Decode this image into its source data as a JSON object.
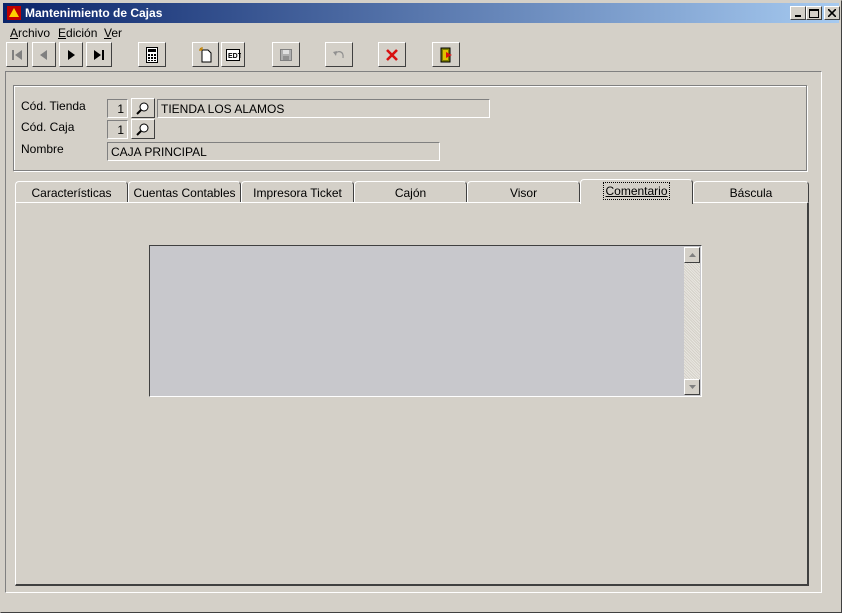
{
  "window": {
    "title": "Mantenimiento de Cajas"
  },
  "menu": {
    "items": [
      {
        "first": "A",
        "rest": "rchivo"
      },
      {
        "first": "E",
        "rest": "dición"
      },
      {
        "first": "V",
        "rest": "er"
      }
    ]
  },
  "toolbar": {
    "icons": [
      "first-record-icon",
      "prev-record-icon",
      "next-record-icon",
      "last-record-icon",
      "calculator-icon",
      "new-record-icon",
      "edit-record-icon",
      "save-icon",
      "undo-icon",
      "delete-icon",
      "exit-icon"
    ]
  },
  "form": {
    "tienda_label": "Cód. Tienda",
    "tienda_code": "1",
    "tienda_name": "TIENDA LOS ALAMOS",
    "caja_label": "Cód. Caja",
    "caja_code": "1",
    "nombre_label": "Nombre",
    "nombre_value": "CAJA PRINCIPAL"
  },
  "tabs": [
    {
      "label": "Características"
    },
    {
      "label": "Cuentas Contables"
    },
    {
      "label": "Impresora Ticket"
    },
    {
      "label": "Cajón"
    },
    {
      "label": "Visor"
    },
    {
      "label": "Comentario"
    },
    {
      "label": "Báscula"
    }
  ],
  "active_tab": "Comentario",
  "comentario": {
    "text": ""
  },
  "colors": {
    "title_start": "#0a246a",
    "title_end": "#a6caf0",
    "face": "#d4d0c8",
    "memo_bg": "#c8c8cc",
    "delete_red": "#d81010"
  }
}
